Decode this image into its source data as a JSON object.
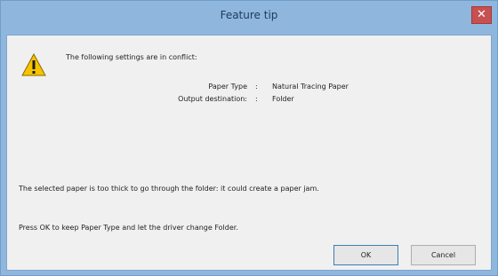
{
  "window": {
    "title": "Feature tip",
    "close_glyph": "✕"
  },
  "message": {
    "icon": "warning-icon",
    "conflict_intro": "The following settings are in conflict:",
    "settings": [
      {
        "label": "Paper Type",
        "separator": ":",
        "value": "Natural Tracing Paper"
      },
      {
        "label": "Output destination:",
        "separator": ":",
        "value": "Folder"
      }
    ],
    "explanation": "The selected paper is too thick to go through the folder: it could create a paper jam.",
    "instruction": "Press OK to keep Paper Type and let the driver change Folder."
  },
  "buttons": {
    "ok_label": "OK",
    "cancel_label": "Cancel"
  },
  "colors": {
    "titlebar": "#8fb6dd",
    "close_button": "#c75050",
    "client_background": "#f0f0f0",
    "warning_yellow": "#f7c300"
  }
}
